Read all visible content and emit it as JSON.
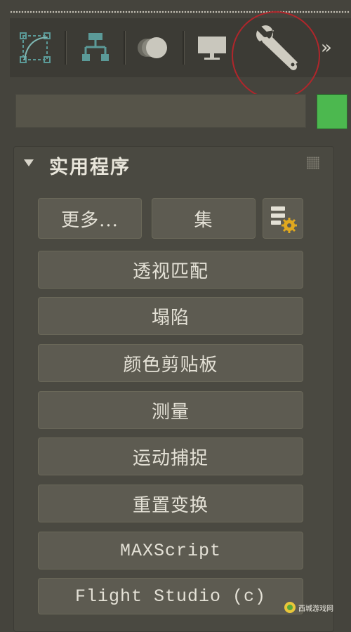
{
  "tabs": [
    {
      "name": "create"
    },
    {
      "name": "hierarchy"
    },
    {
      "name": "motion"
    },
    {
      "name": "display"
    },
    {
      "name": "utilities",
      "active": true
    }
  ],
  "more_tabs_glyph": "»",
  "object_color": "#4cb84f",
  "rollout": {
    "title": "实用程序",
    "more_button": "更多...",
    "sets_button": "集",
    "items": [
      "透视匹配",
      "塌陷",
      "颜色剪贴板",
      "测量",
      "运动捕捉",
      "重置变换",
      "MAXScript",
      "Flight Studio (c)"
    ]
  },
  "watermark": {
    "text": "西城游戏网"
  }
}
